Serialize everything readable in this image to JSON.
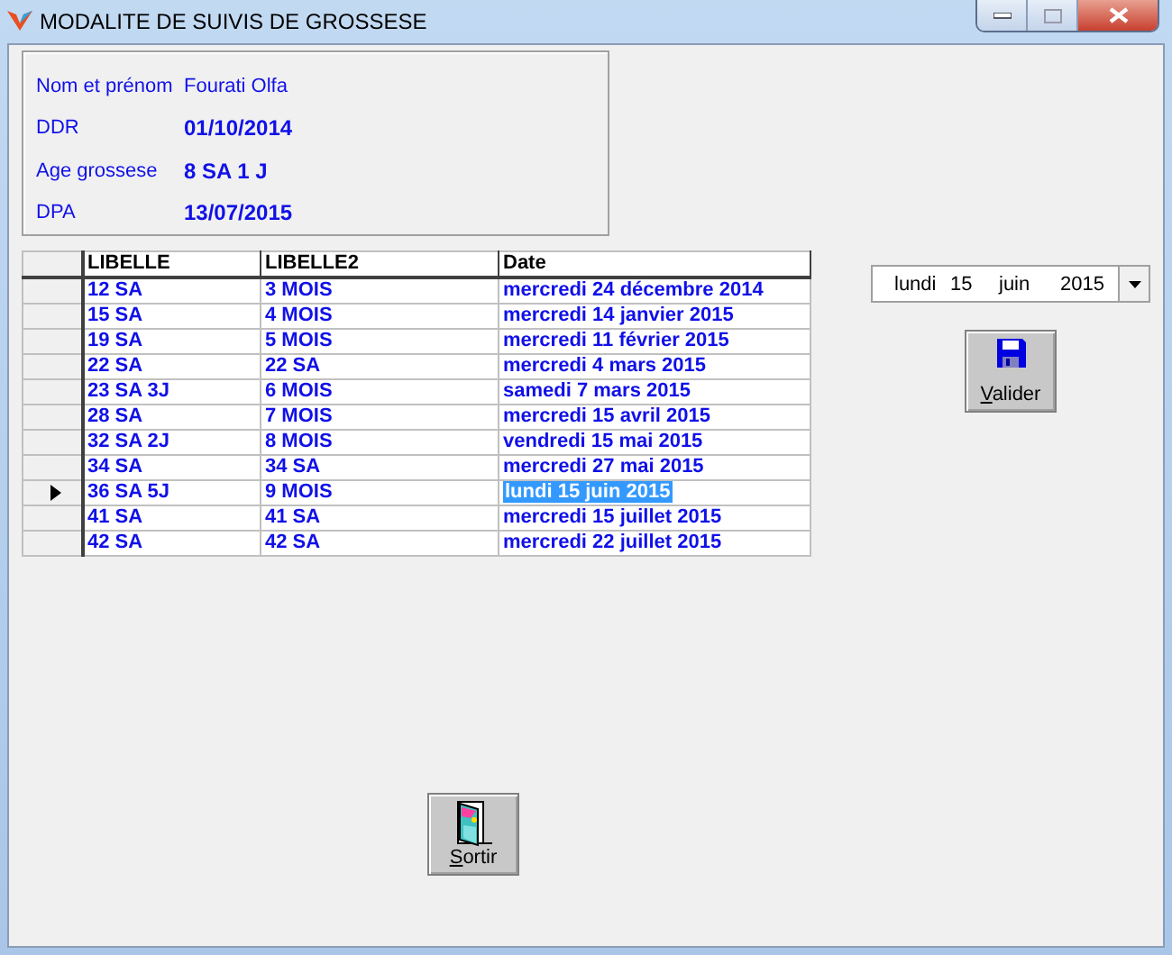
{
  "window": {
    "title": "MODALITE DE SUIVIS DE GROSSESE"
  },
  "patient": [
    {
      "label": "Nom et prénom",
      "value": "Fourati Olfa",
      "kind": "plain"
    },
    {
      "label": "DDR",
      "value": "01/10/2014",
      "kind": "bold"
    },
    {
      "label": "Age grossese",
      "value": "8 SA 1 J",
      "kind": "bold"
    },
    {
      "label": "DPA",
      "value": "13/07/2015",
      "kind": "bold"
    }
  ],
  "table": {
    "columns": [
      "LIBELLE",
      "LIBELLE2",
      "Date"
    ],
    "rows": [
      {
        "cells": [
          "12 SA",
          "3 MOIS",
          "mercredi 24 décembre 2014"
        ],
        "selected": false
      },
      {
        "cells": [
          "15 SA",
          "4 MOIS",
          "mercredi 14 janvier 2015"
        ],
        "selected": false
      },
      {
        "cells": [
          "19 SA",
          "5 MOIS",
          "mercredi 11 février 2015"
        ],
        "selected": false
      },
      {
        "cells": [
          "22 SA",
          "22 SA",
          "mercredi 4 mars 2015"
        ],
        "selected": false
      },
      {
        "cells": [
          "23 SA 3J",
          "6 MOIS",
          "samedi 7 mars 2015"
        ],
        "selected": false
      },
      {
        "cells": [
          "28 SA",
          "7 MOIS",
          "mercredi 15 avril 2015"
        ],
        "selected": false
      },
      {
        "cells": [
          "32 SA 2J",
          "8 MOIS",
          "vendredi 15 mai 2015"
        ],
        "selected": false
      },
      {
        "cells": [
          "34 SA",
          "34 SA",
          "mercredi 27 mai 2015"
        ],
        "selected": false
      },
      {
        "cells": [
          "36 SA 5J",
          "9 MOIS",
          "lundi 15 juin 2015"
        ],
        "selected": true
      },
      {
        "cells": [
          "41 SA",
          "41 SA",
          "mercredi 15 juillet 2015"
        ],
        "selected": false
      },
      {
        "cells": [
          "42 SA",
          "42 SA",
          "mercredi 22 juillet 2015"
        ],
        "selected": false
      }
    ]
  },
  "date_picker": {
    "weekday": "lundi",
    "day": "15",
    "month": "juin",
    "year": "2015"
  },
  "validate_button": {
    "label": "Valider",
    "kind": "save"
  },
  "exit_button": {
    "label": "Sortir",
    "kind": "exit"
  }
}
